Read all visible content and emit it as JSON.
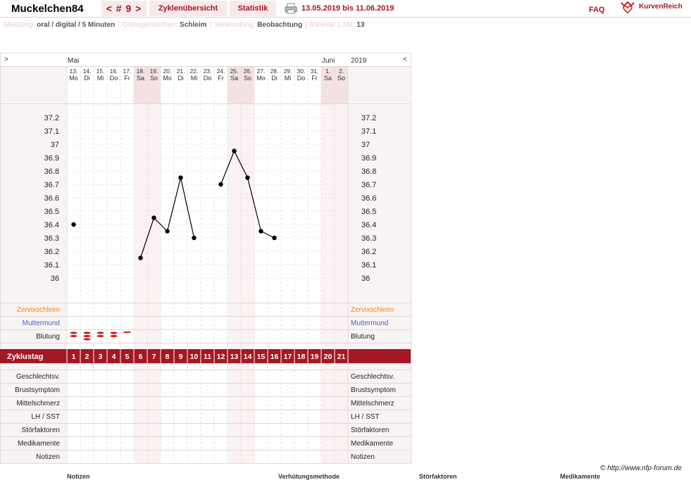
{
  "header": {
    "user": "Muckelchen84",
    "cycle_nav": "< # 9 >",
    "tabs": [
      "Zyklenübersicht",
      "Statistik"
    ],
    "date_range": "13.05.2019 bis 11.06.2019",
    "faq": "FAQ",
    "logo": "KurvenReich",
    "printer_icon": "printer-icon",
    "logo_icon": "heart-crown-icon"
  },
  "info": {
    "messung_key": "Messung:",
    "messung_val": "oral / digital / 5 Minuten",
    "oestro_key": "Östrogenzeichen:",
    "oestro_val": "Schleim",
    "verw_key": "Verwendung:",
    "verw_val": "Beobachtung",
    "hm_key": "früheste 1.hM:",
    "hm_val": "13",
    "sep": "|"
  },
  "nav": {
    "left": ">",
    "right": "<"
  },
  "months": {
    "may": "Mai",
    "june": "Juni",
    "year": "2019"
  },
  "days": [
    {
      "d": "13.",
      "w": "Mo",
      "we": false
    },
    {
      "d": "14.",
      "w": "Di",
      "we": false
    },
    {
      "d": "15.",
      "w": "Mi",
      "we": false
    },
    {
      "d": "16.",
      "w": "Do",
      "we": false
    },
    {
      "d": "17.",
      "w": "Fr",
      "we": false
    },
    {
      "d": "18.",
      "w": "Sa",
      "we": true
    },
    {
      "d": "19.",
      "w": "So",
      "we": true
    },
    {
      "d": "20.",
      "w": "Mo",
      "we": false
    },
    {
      "d": "21.",
      "w": "Di",
      "we": false
    },
    {
      "d": "22.",
      "w": "Mi",
      "we": false
    },
    {
      "d": "23.",
      "w": "Do",
      "we": false
    },
    {
      "d": "24.",
      "w": "Fr",
      "we": false
    },
    {
      "d": "25.",
      "w": "Sa",
      "we": true
    },
    {
      "d": "26.",
      "w": "So",
      "we": true
    },
    {
      "d": "27.",
      "w": "Mo",
      "we": false
    },
    {
      "d": "28.",
      "w": "Di",
      "we": false
    },
    {
      "d": "29.",
      "w": "Mi",
      "we": false
    },
    {
      "d": "30.",
      "w": "Do",
      "we": false
    },
    {
      "d": "31.",
      "w": "Fr",
      "we": false
    },
    {
      "d": "1.",
      "w": "Sa",
      "we": true
    },
    {
      "d": "2.",
      "w": "So",
      "we": true
    }
  ],
  "chart_data": {
    "type": "line",
    "x": [
      1,
      2,
      3,
      4,
      5,
      6,
      7,
      8,
      9,
      10,
      11,
      12,
      13,
      14,
      15,
      16,
      17,
      18,
      19,
      20,
      21
    ],
    "y_ticks": [
      "37.2",
      "37.1",
      "37",
      "36.9",
      "36.8",
      "36.7",
      "36.6",
      "36.5",
      "36.4",
      "36.3",
      "36.2",
      "36.1",
      "36"
    ],
    "ylim": [
      36.0,
      37.2
    ],
    "points": [
      {
        "day": 1,
        "temp": 36.4
      },
      {
        "day": 6,
        "temp": 36.15
      },
      {
        "day": 7,
        "temp": 36.45
      },
      {
        "day": 8,
        "temp": 36.35
      },
      {
        "day": 9,
        "temp": 36.75
      },
      {
        "day": 10,
        "temp": 36.3
      },
      {
        "day": 12,
        "temp": 36.7
      },
      {
        "day": 13,
        "temp": 36.95
      },
      {
        "day": 14,
        "temp": 36.75
      },
      {
        "day": 15,
        "temp": 36.35
      },
      {
        "day": 16,
        "temp": 36.3
      }
    ],
    "segments": [
      [
        1
      ],
      [
        6,
        7,
        8,
        9,
        10
      ],
      [
        12,
        13,
        14,
        15,
        16
      ]
    ],
    "bleeding": [
      {
        "day": 1,
        "level": 3
      },
      {
        "day": 2,
        "level": 4
      },
      {
        "day": 3,
        "level": 3
      },
      {
        "day": 4,
        "level": 3
      },
      {
        "day": 5,
        "level": 1
      }
    ],
    "grid": true
  },
  "rows": {
    "zervix": "Zervixschleim",
    "muttermund": "Muttermund",
    "blutung": "Blutung",
    "zyklustag": "Zyklustag",
    "lower": [
      "Geschlechtsv.",
      "Brustsymptom",
      "Mittelschmerz",
      "LH / SST",
      "Störfaktoren",
      "Medikamente",
      "Notizen"
    ]
  },
  "colors": {
    "accent": "#a41824",
    "weekend": "#f3e1e4",
    "grid": "#e7dede",
    "orange": "#e8860b",
    "blue": "#4a5fc8",
    "blood": "#d41c1c"
  },
  "copyright": "© http://www.nfp-forum.de",
  "footer": [
    "Notizen",
    "Verhütungsmethode",
    "Störfaktoren",
    "Medikamente"
  ]
}
